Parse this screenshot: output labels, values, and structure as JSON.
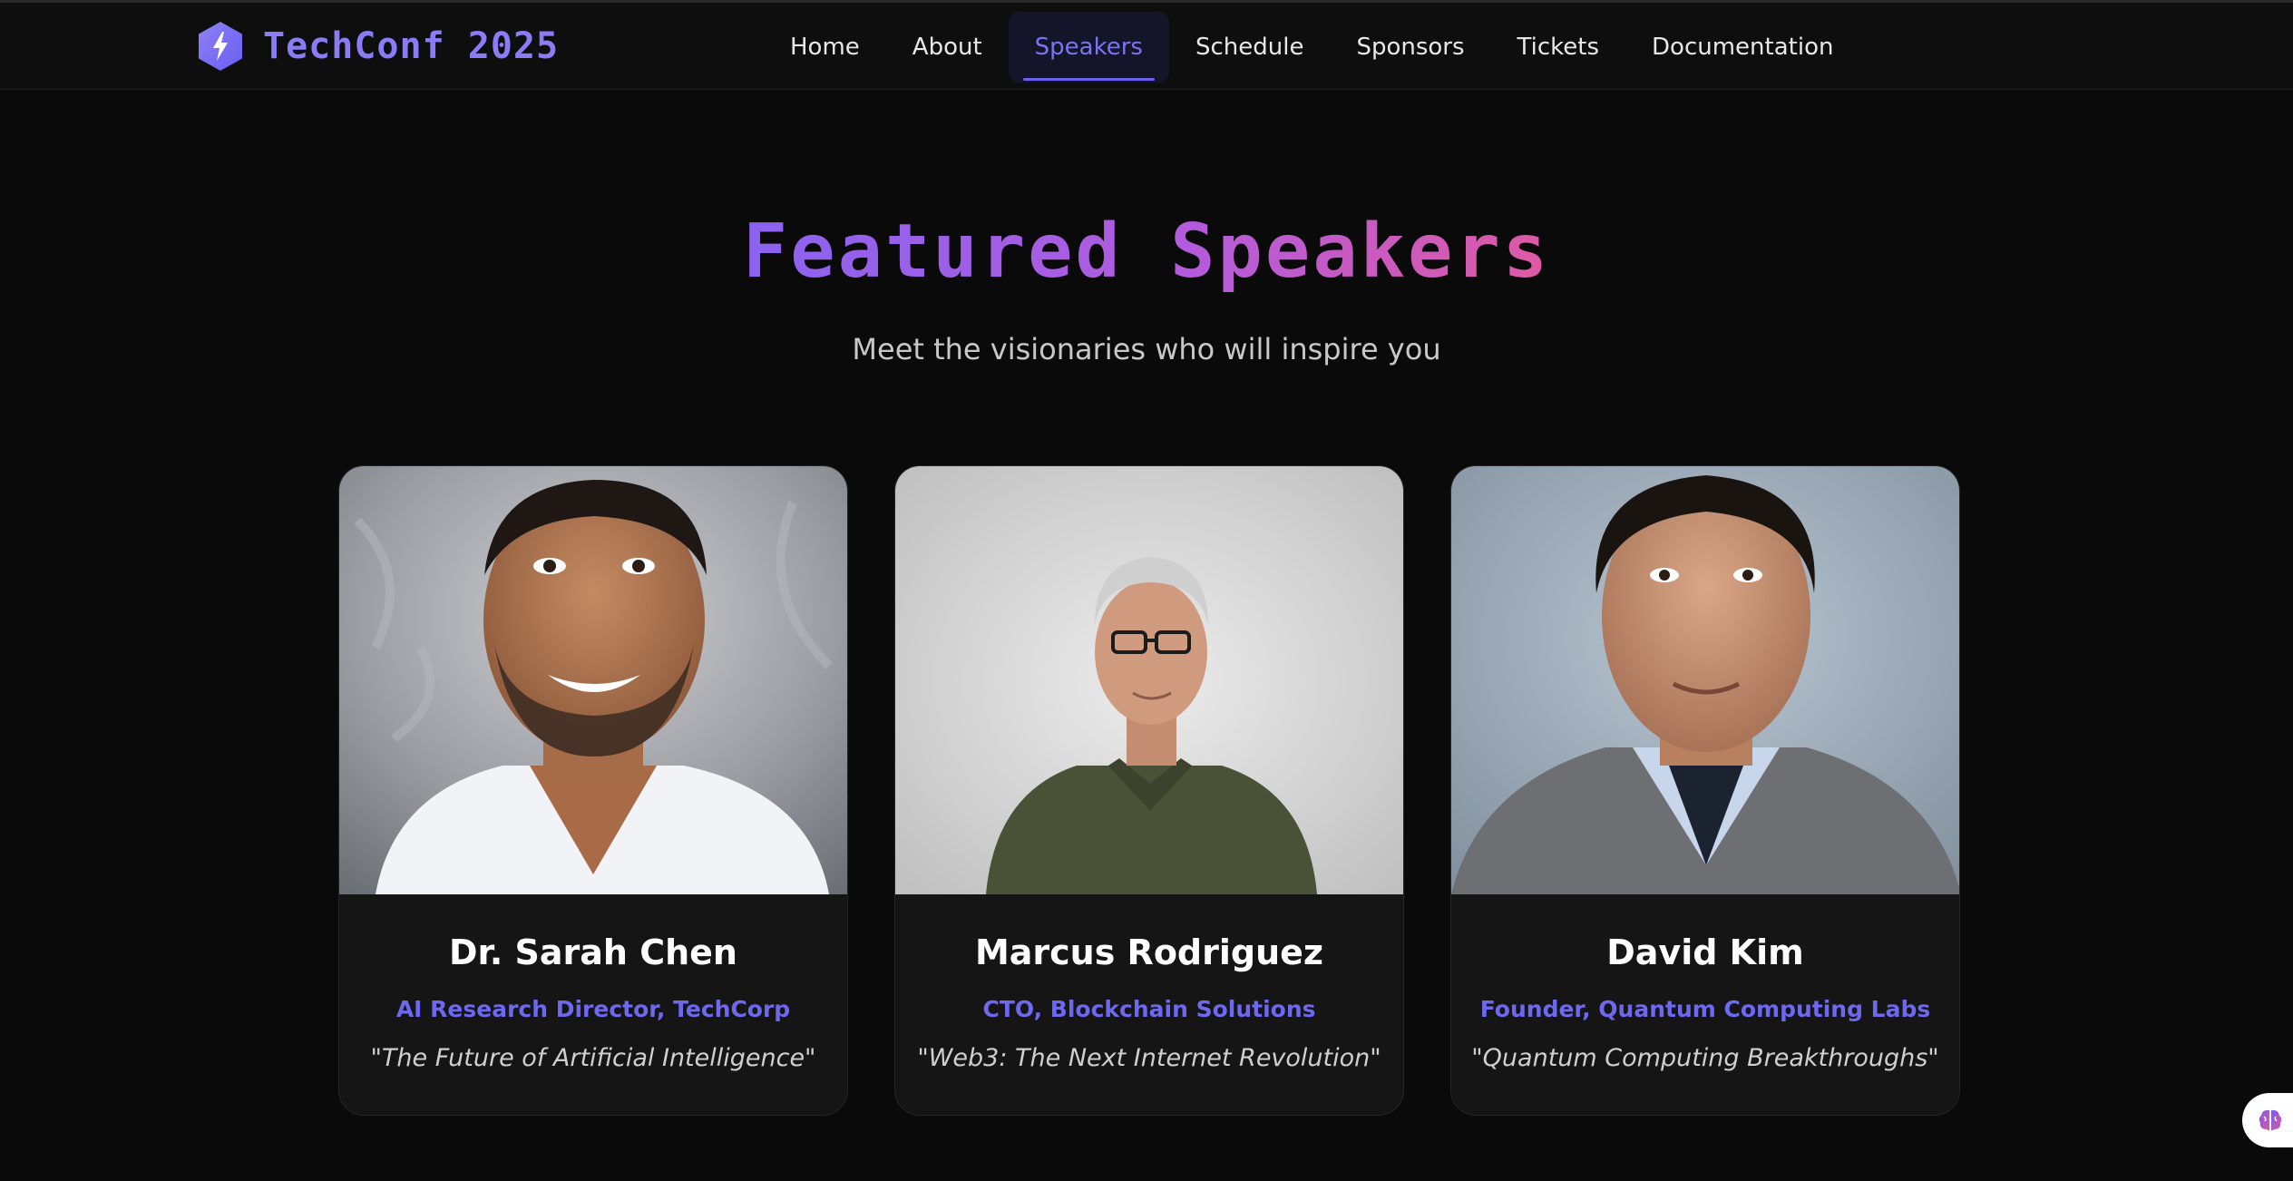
{
  "header": {
    "brand_title": "TechConf 2025",
    "nav": [
      {
        "label": "Home"
      },
      {
        "label": "About"
      },
      {
        "label": "Speakers",
        "active": true
      },
      {
        "label": "Schedule"
      },
      {
        "label": "Sponsors"
      },
      {
        "label": "Tickets"
      },
      {
        "label": "Documentation"
      }
    ]
  },
  "hero": {
    "title": "Featured Speakers",
    "subtitle": "Meet the visionaries who will inspire you"
  },
  "speakers": [
    {
      "name": "Dr. Sarah Chen",
      "role": "AI Research Director, TechCorp",
      "talk": "\"The Future of Artificial Intelligence\"",
      "photo_icon": "speaker-photo-1"
    },
    {
      "name": "Marcus Rodriguez",
      "role": "CTO, Blockchain Solutions",
      "talk": "\"Web3: The Next Internet Revolution\"",
      "photo_icon": "speaker-photo-2"
    },
    {
      "name": "David Kim",
      "role": "Founder, Quantum Computing Labs",
      "talk": "\"Quantum Computing Breakthroughs\"",
      "photo_icon": "speaker-photo-3"
    }
  ],
  "colors": {
    "background": "#0a0a0a",
    "accent": "#6d68ee",
    "title_gradient": [
      "#8a63f0",
      "#de5aa5"
    ]
  },
  "icons": {
    "brand": "lightning-hexagon-icon",
    "floating": "brain-icon"
  }
}
